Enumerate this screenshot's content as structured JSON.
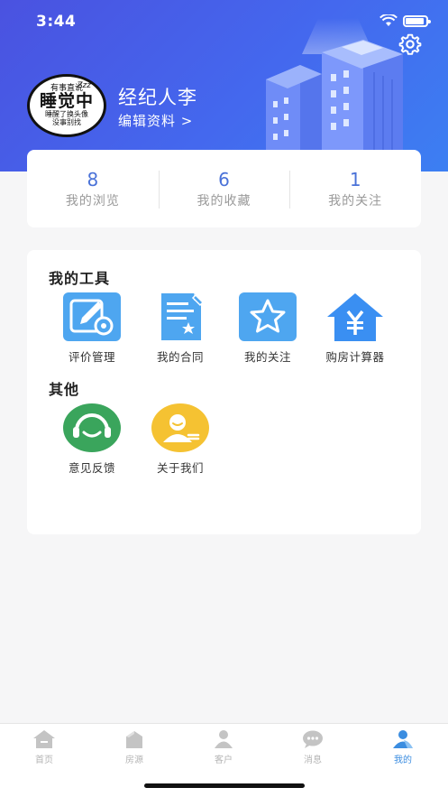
{
  "status_bar": {
    "time": "3:44"
  },
  "colors": {
    "header": "#4a52e0",
    "accent": "#4a72d8",
    "tab_active": "#3b8de0",
    "feedback": "#3aa55c",
    "about": "#f5c232"
  },
  "profile": {
    "avatar_text": {
      "line1": "有事直说",
      "line2": "睡觉中",
      "line3": "睡醒了换头像",
      "line4": "没事别找",
      "zz": "Zzz"
    },
    "name": "经纪人李",
    "edit_label": "编辑资料 >"
  },
  "stats": [
    {
      "value": "8",
      "label": "我的浏览"
    },
    {
      "value": "6",
      "label": "我的收藏"
    },
    {
      "value": "1",
      "label": "我的关注"
    }
  ],
  "tools_section": {
    "title": "我的工具",
    "items": [
      {
        "label": "评价管理",
        "icon": "edit-settings-icon"
      },
      {
        "label": "我的合同",
        "icon": "contract-icon"
      },
      {
        "label": "我的关注",
        "icon": "star-icon"
      },
      {
        "label": "购房计算器",
        "icon": "house-yuan-icon"
      }
    ]
  },
  "other_section": {
    "title": "其他",
    "items": [
      {
        "label": "意见反馈",
        "icon": "headset-icon"
      },
      {
        "label": "关于我们",
        "icon": "user-icon"
      }
    ]
  },
  "tabbar": [
    {
      "label": "首页",
      "icon": "home-icon"
    },
    {
      "label": "房源",
      "icon": "house-icon"
    },
    {
      "label": "客户",
      "icon": "person-icon"
    },
    {
      "label": "消息",
      "icon": "chat-icon"
    },
    {
      "label": "我的",
      "icon": "profile-icon",
      "active": true
    }
  ]
}
